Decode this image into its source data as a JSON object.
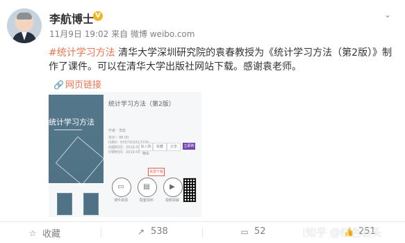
{
  "author": {
    "name": "李航博士",
    "verified_icon": "verified-badge-icon"
  },
  "post": {
    "meta": "11月9日 19:02 来自 微博 weibo.com",
    "hashtag": "#统计学习方法",
    "content_line1_rest": " 清华大学深圳研究院的袁春教授为《统计学习方法（第2版）》制",
    "content_line2": "作了课件。可以在清华大学出版社网站下载。感谢袁老师。",
    "link_text": "网页链接",
    "link_icon": "link-icon"
  },
  "preview": {
    "title": "统计学习方法（第2版）",
    "author_line": "作者：李航",
    "book_cover_title": "统计学习方法",
    "buttons": {
      "gray1": "加入购物车",
      "gray2": "收藏",
      "gray3": "分享",
      "purple": "立即购买",
      "tab_red": "资源下载"
    },
    "actions": [
      {
        "icon": "monitor-icon",
        "label": "课件资源"
      },
      {
        "icon": "document-icon",
        "label": "配套资料"
      },
      {
        "icon": "play-icon",
        "label": "视频讲解"
      }
    ],
    "details": [
      "定价：98.00",
      "ISBN：9787302517276",
      "出版时间：2019.05",
      "印刷时间：2019.05"
    ]
  },
  "footer": {
    "favorite_label": "收藏",
    "share_count": "538",
    "comment_count": "52",
    "like_count": "251",
    "favorite_icon": "star-icon",
    "share_icon": "share-icon",
    "comment_icon": "comment-icon",
    "like_icon": "thumbs-up-icon"
  },
  "watermark": "知乎 @红色石头",
  "ui": {
    "more_icon": "chevron-down-icon"
  }
}
